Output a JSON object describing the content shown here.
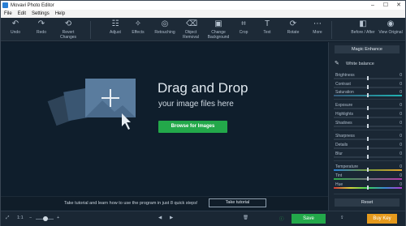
{
  "window": {
    "title": "Movavi Photo Editor"
  },
  "menu": [
    "File",
    "Edit",
    "Settings",
    "Help"
  ],
  "toolbar": {
    "undo": "Undo",
    "redo": "Redo",
    "revert": "Revert Changes",
    "adjust": "Adjust",
    "effects": "Effects",
    "retouching": "Retouching",
    "object_removal": "Object Removal",
    "change_background": "Change Background",
    "crop": "Crop",
    "text": "Text",
    "rotate": "Rotate",
    "more": "More",
    "before_after": "Before / After",
    "view_original": "View Original"
  },
  "canvas": {
    "heading": "Drag and Drop",
    "subheading": "your image files here",
    "browse_label": "Browse for Images",
    "tutorial_text": "Take tutorial and learn how to use the program in just 8 quick steps!",
    "tutorial_button": "Take tutorial"
  },
  "bottom": {
    "zoom_label": "1:1",
    "save_label": "Save",
    "buy_key_label": "Buy Key"
  },
  "panel": {
    "magic_label": "Magic Enhance",
    "white_balance_label": "White balance",
    "sliders": [
      {
        "label": "Brightness",
        "value": "0"
      },
      {
        "label": "Contrast",
        "value": "0"
      },
      {
        "label": "Saturation",
        "value": "0"
      },
      {
        "label": "Exposure",
        "value": "0"
      },
      {
        "label": "Highlights",
        "value": "0"
      },
      {
        "label": "Shadows",
        "value": "0"
      },
      {
        "label": "Sharpness",
        "value": "0"
      },
      {
        "label": "Details",
        "value": "0"
      },
      {
        "label": "Blur",
        "value": "0"
      },
      {
        "label": "Temperature",
        "value": "0"
      },
      {
        "label": "Tint",
        "value": "0"
      },
      {
        "label": "Hue",
        "value": "0"
      }
    ],
    "reset_label": "Reset"
  },
  "colors": {
    "accent_green": "#23a84a",
    "buy_orange": "#e69a1c",
    "background": "#0f1e2c"
  }
}
